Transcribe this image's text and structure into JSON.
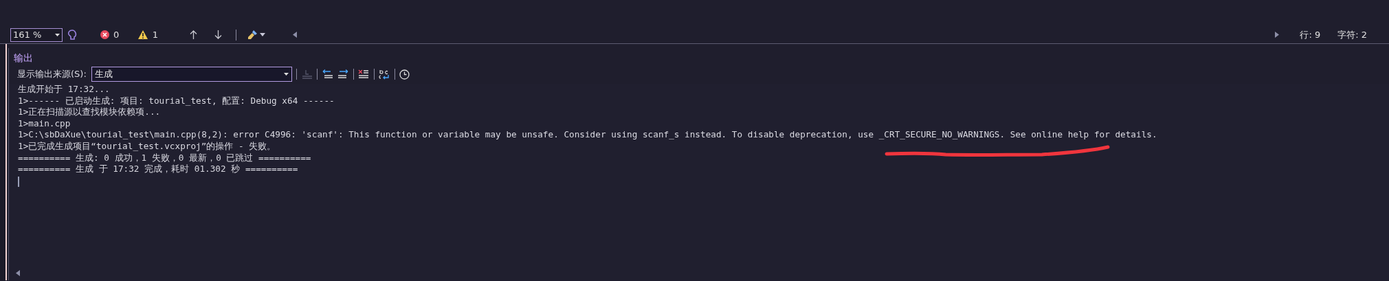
{
  "editor_toolbar": {
    "zoom": "161 %",
    "errors": "0",
    "warnings": "1",
    "line": "行: 9",
    "char": "字符: 2"
  },
  "output_panel": {
    "title": "输出",
    "source_label": "显示输出来源(S):",
    "source_value": "生成",
    "lines": [
      "生成开始于 17:32...",
      "1>------ 已启动生成: 项目: tourial_test, 配置: Debug x64 ------",
      "1>正在扫描源以查找模块依赖项...",
      "1>main.cpp",
      "1>C:\\sbDaXue\\tourial_test\\main.cpp(8,2): error C4996: 'scanf': This function or variable may be unsafe. Consider using scanf_s instead. To disable deprecation, use _CRT_SECURE_NO_WARNINGS. See online help for details.",
      "1>已完成生成项目“tourial_test.vcxproj”的操作 - 失败。",
      "========== 生成: 0 成功，1 失败，0 最新，0 已跳过 ==========",
      "========== 生成 于 17:32 完成，耗时 01.302 秒 =========="
    ]
  }
}
